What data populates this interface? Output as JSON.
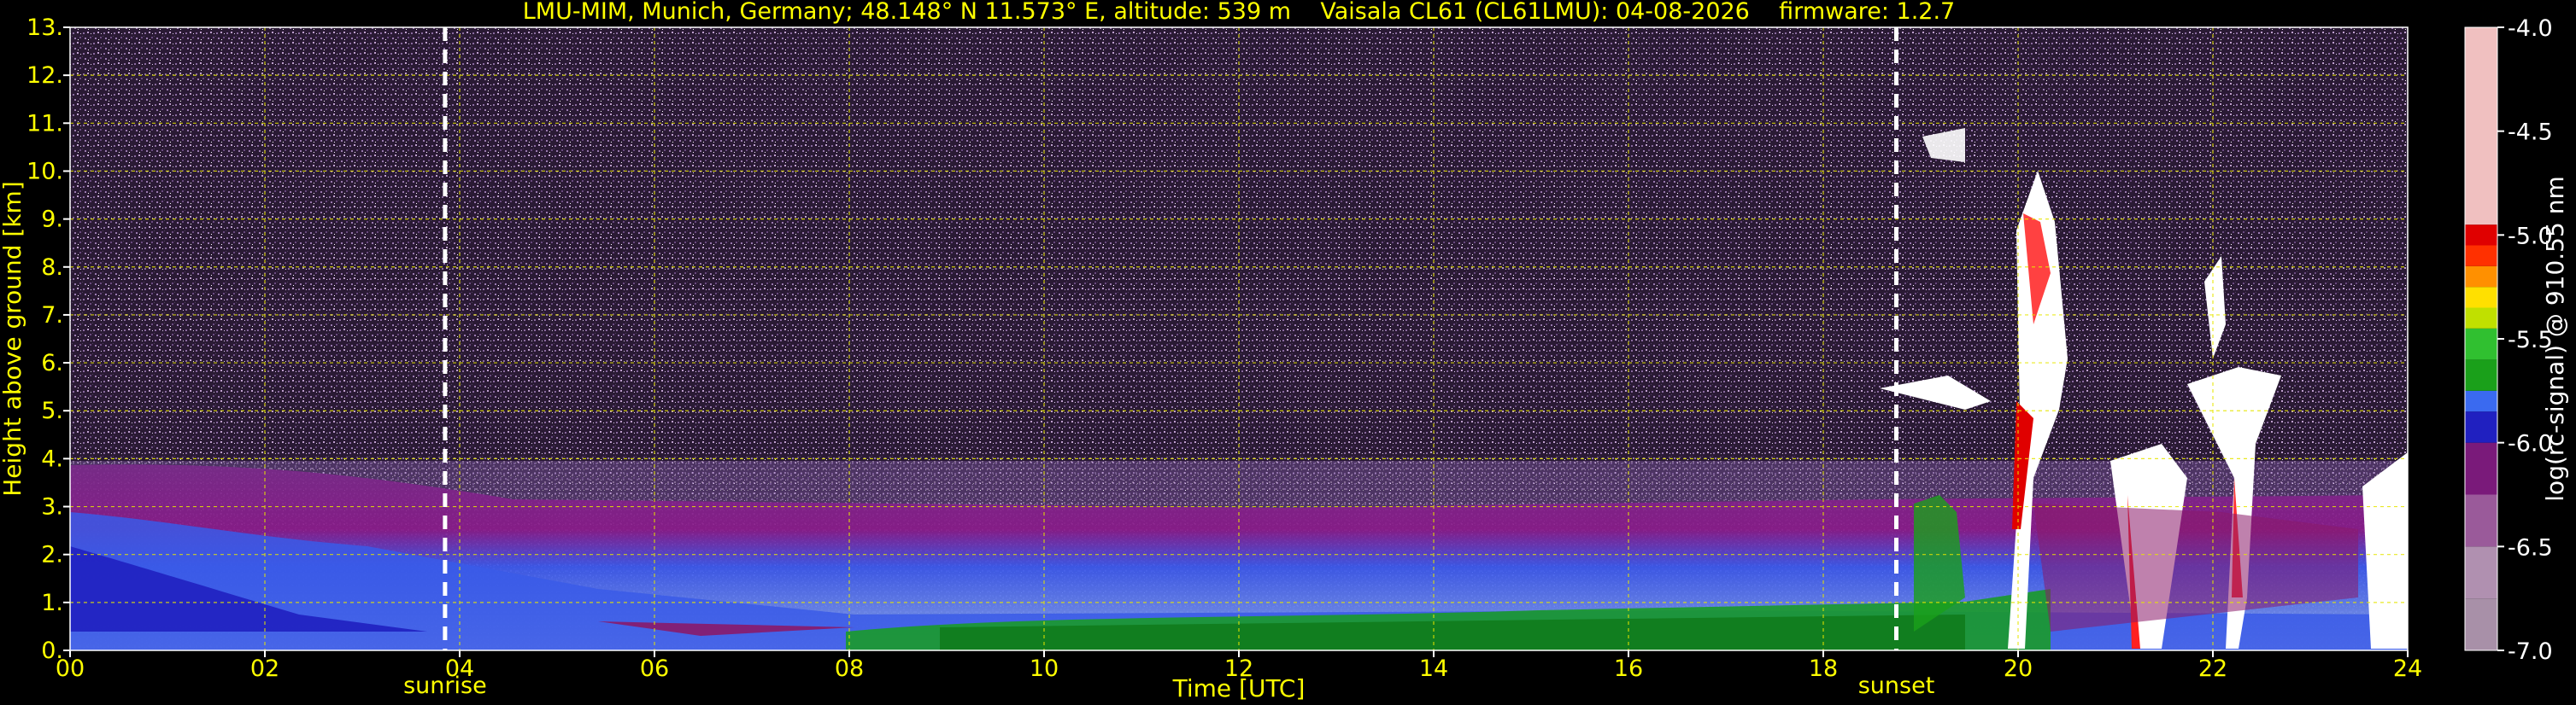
{
  "chart_data": {
    "type": "heatmap",
    "title": "LMU-MIM, Munich, Germany; 48.148° N 11.573° E, altitude: 539 m    Vaisala CL61 (CL61LMU): 04-08-2026    firmware: 1.2.7",
    "xlabel": "Time [UTC]",
    "ylabel": "Height above ground [km]",
    "xlim": [
      0,
      24
    ],
    "ylim": [
      0,
      13
    ],
    "x_ticks": [
      0,
      2,
      4,
      6,
      8,
      10,
      12,
      14,
      16,
      18,
      20,
      22,
      24
    ],
    "x_tick_labels": [
      "00",
      "02",
      "04",
      "06",
      "08",
      "10",
      "12",
      "14",
      "16",
      "18",
      "20",
      "22",
      "24"
    ],
    "y_ticks": [
      0,
      1,
      2,
      3,
      4,
      5,
      6,
      7,
      8,
      9,
      10,
      11,
      12,
      13
    ],
    "y_tick_labels": [
      "0.",
      "1.",
      "2.",
      "3.",
      "4.",
      "5.",
      "6.",
      "7.",
      "8.",
      "9.",
      "10.",
      "11.",
      "12.",
      "13."
    ],
    "grid": true,
    "annotations": [
      {
        "label": "sunrise",
        "x": 3.85
      },
      {
        "label": "sunset",
        "x": 18.75
      }
    ],
    "colorbar": {
      "label": "log(rc-signal) @ 910.55 nm",
      "range": [
        -7.0,
        -4.0
      ],
      "ticks": [
        -4.0,
        -4.5,
        -5.0,
        -5.5,
        -6.0,
        -6.5,
        -7.0
      ],
      "tick_labels": [
        "-4.0",
        "-4.5",
        "-5.0",
        "-5.5",
        "-6.0",
        "-6.5",
        "-7.0"
      ],
      "colors": [
        "#a890a8",
        "#b090b0",
        "#9a5a9a",
        "#7a1a7a",
        "#2020c0",
        "#3a6af0",
        "#1aa01a",
        "#30c030",
        "#c0e000",
        "#ffe000",
        "#ff9000",
        "#ff3000",
        "#e00000",
        "#f0c0c0",
        "#ffffff"
      ],
      "color_stops": [
        -7.0,
        -6.75,
        -6.5,
        -6.25,
        -6.0,
        -5.85,
        -5.75,
        -5.6,
        -5.45,
        -5.35,
        -5.25,
        -5.15,
        -5.05,
        -4.95,
        -4.0
      ]
    }
  }
}
